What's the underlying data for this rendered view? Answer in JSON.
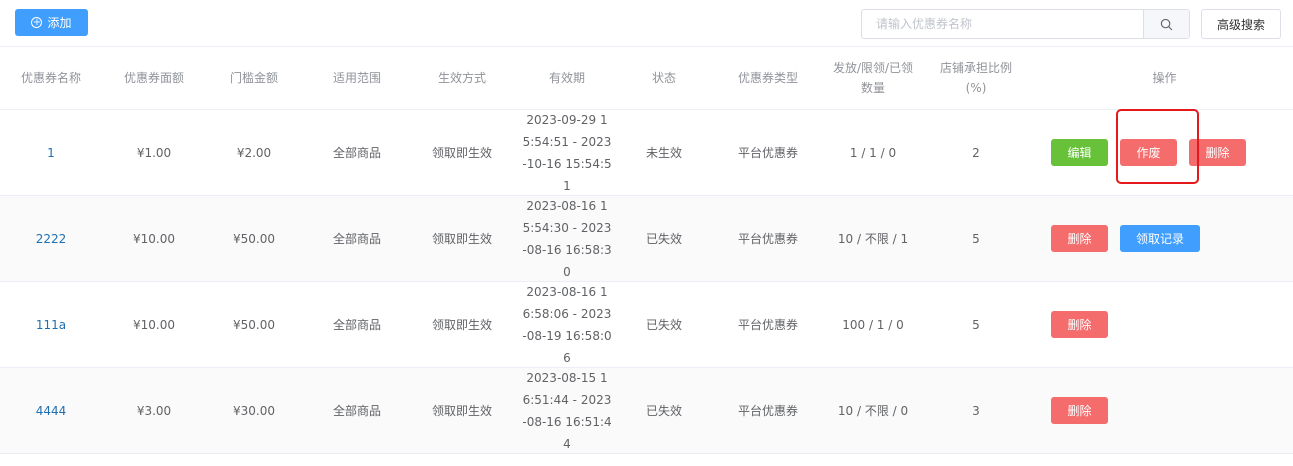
{
  "toolbar": {
    "add_label": "添加",
    "search_placeholder": "请输入优惠券名称",
    "advanced_search_label": "高级搜索"
  },
  "table": {
    "headers": [
      "优惠券名称",
      "优惠券面额",
      "门槛金额",
      "适用范围",
      "生效方式",
      "有效期",
      "状态",
      "优惠券类型",
      "发放/限领/已领\n数量",
      "店铺承担比例\n(%)",
      "操作"
    ],
    "rows": [
      {
        "name": "1",
        "amount": "¥1.00",
        "threshold": "¥2.00",
        "scope": "全部商品",
        "effect": "领取即生效",
        "period": "2023-09-29 15:54:51 - 2023-10-16 15:54:51",
        "status": "未生效",
        "type": "平台优惠券",
        "quantity": "1 / 1 / 0",
        "ratio": "2",
        "actions": [
          "编辑",
          "作废",
          "删除"
        ]
      },
      {
        "name": "2222",
        "amount": "¥10.00",
        "threshold": "¥50.00",
        "scope": "全部商品",
        "effect": "领取即生效",
        "period": "2023-08-16 15:54:30 - 2023-08-16 16:58:30",
        "status": "已失效",
        "type": "平台优惠券",
        "quantity": "10 / 不限 / 1",
        "ratio": "5",
        "actions": [
          "删除",
          "领取记录"
        ]
      },
      {
        "name": "111a",
        "amount": "¥10.00",
        "threshold": "¥50.00",
        "scope": "全部商品",
        "effect": "领取即生效",
        "period": "2023-08-16 16:58:06 - 2023-08-19 16:58:06",
        "status": "已失效",
        "type": "平台优惠券",
        "quantity": "100 / 1 / 0",
        "ratio": "5",
        "actions": [
          "删除"
        ]
      },
      {
        "name": "4444",
        "amount": "¥3.00",
        "threshold": "¥30.00",
        "scope": "全部商品",
        "effect": "领取即生效",
        "period": "2023-08-15 16:51:44 - 2023-08-16 16:51:44",
        "status": "已失效",
        "type": "平台优惠券",
        "quantity": "10 / 不限 / 0",
        "ratio": "3",
        "actions": [
          "删除"
        ]
      }
    ]
  },
  "colors": {
    "primary": "#409eff",
    "success": "#67c23a",
    "danger": "#f56c6c",
    "highlight": "#e5191b"
  },
  "icons": {
    "add": "plus-circle-icon",
    "search": "search-icon"
  }
}
